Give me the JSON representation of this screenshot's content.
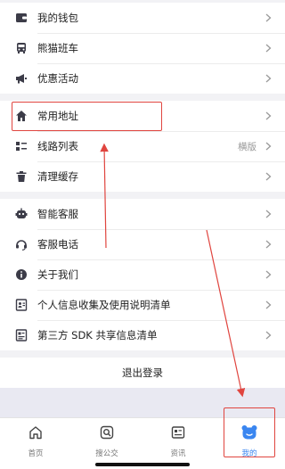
{
  "group1": [
    {
      "label": "我的钱包",
      "icon": "wallet-icon"
    },
    {
      "label": "熊猫班车",
      "icon": "bus-icon"
    },
    {
      "label": "优惠活动",
      "icon": "megaphone-icon"
    }
  ],
  "group2": [
    {
      "label": "常用地址",
      "icon": "home-icon",
      "extra": ""
    },
    {
      "label": "线路列表",
      "icon": "list-icon",
      "extra": "横版"
    },
    {
      "label": "清理缓存",
      "icon": "trash-icon",
      "extra": ""
    }
  ],
  "group3": [
    {
      "label": "智能客服",
      "icon": "robot-icon"
    },
    {
      "label": "客服电话",
      "icon": "headset-icon"
    },
    {
      "label": "关于我们",
      "icon": "info-icon"
    },
    {
      "label": "个人信息收集及使用说明清单",
      "icon": "id-card-icon"
    },
    {
      "label": "第三方 SDK 共享信息清单",
      "icon": "sdk-list-icon"
    }
  ],
  "logout": "退出登录",
  "tabs": [
    {
      "label": "首页",
      "icon": "home-tab-icon",
      "active": false
    },
    {
      "label": "搜公交",
      "icon": "search-bus-icon",
      "active": false
    },
    {
      "label": "资讯",
      "icon": "news-icon",
      "active": false
    },
    {
      "label": "我的",
      "icon": "bear-face-icon",
      "active": true
    }
  ],
  "colors": {
    "accent": "#3a86f0",
    "highlight": "#e0453f",
    "icon": "#3c3c48"
  }
}
